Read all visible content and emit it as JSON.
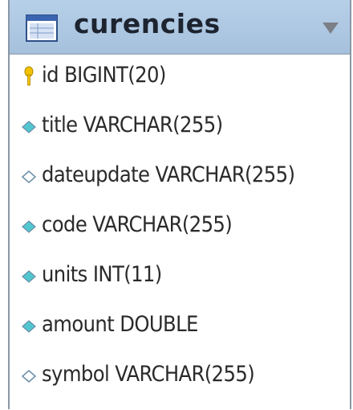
{
  "table": {
    "name": "curencies",
    "columns": [
      {
        "label": "id BIGINT(20)",
        "kind": "primary-key"
      },
      {
        "label": "title VARCHAR(255)",
        "kind": "not-null"
      },
      {
        "label": "dateupdate VARCHAR(255)",
        "kind": "nullable"
      },
      {
        "label": "code VARCHAR(255)",
        "kind": "not-null"
      },
      {
        "label": "units INT(11)",
        "kind": "not-null"
      },
      {
        "label": "amount DOUBLE",
        "kind": "not-null"
      },
      {
        "label": "symbol VARCHAR(255)",
        "kind": "nullable"
      }
    ]
  },
  "colors": {
    "header": "#abc5df",
    "diamond_fill": "#52c6cf",
    "diamond_outline": "#6a8ea8",
    "key": "#f2c200"
  },
  "icons": {
    "table": "table-icon",
    "menu": "chevron-down-icon",
    "primary_key": "key-icon",
    "not_null": "filled-diamond-icon",
    "nullable": "hollow-diamond-icon"
  }
}
